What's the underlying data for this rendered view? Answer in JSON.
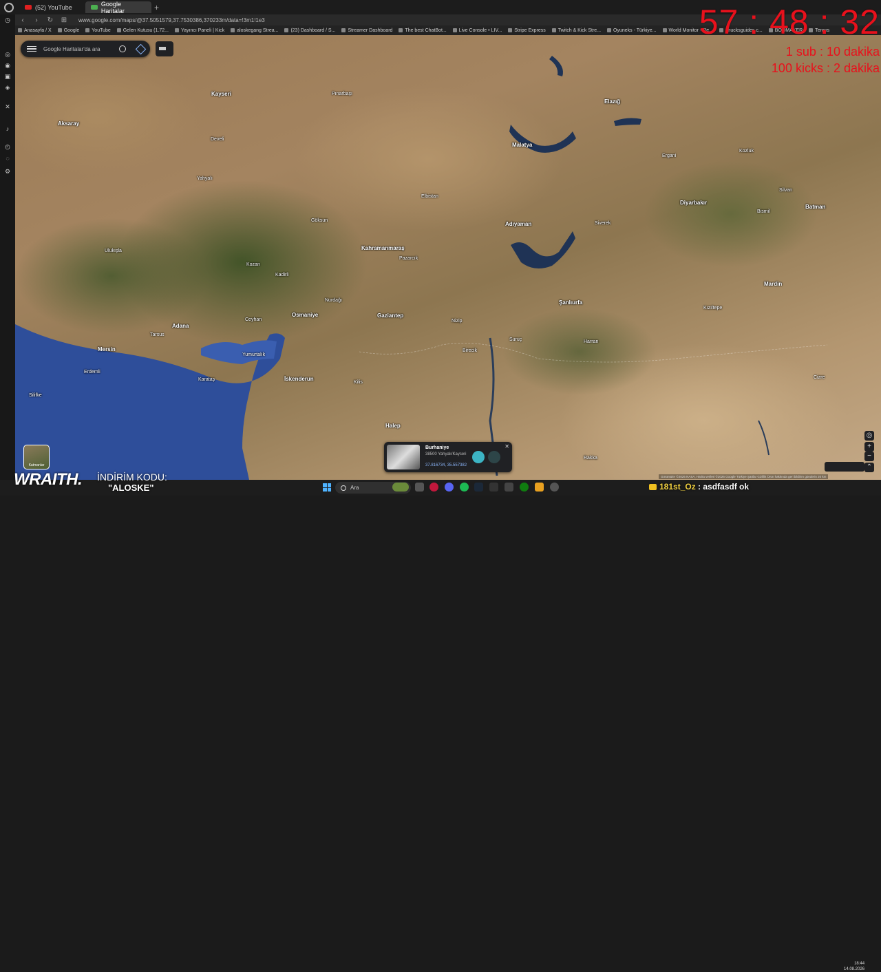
{
  "browser": {
    "tabs": [
      {
        "label": "(52) YouTube",
        "active": false,
        "icon": "youtube-icon"
      },
      {
        "label": "Google Haritalar",
        "active": true,
        "icon": "google-maps-icon"
      }
    ],
    "url": "www.google.com/maps/@37.5051579,37.7530386,370233m/data=!3m1!1e3",
    "bookmarks": [
      "Anasayfa / X",
      "Google",
      "YouTube",
      "Gelen Kutusu (1.72...",
      "Yayıncı Paneli | Kick",
      "aloskegang Strea...",
      "(23) Dashboard / S...",
      "Streamer Dashboard",
      "The best ChatBot...",
      "Live Console • LIV...",
      "Stripe Express",
      "Twitch & Kick Stre...",
      "Oyuneks - Türkiye...",
      "World Monitor - Re...",
      "chucksguides.c...",
      "BOOMAKER",
      "Terons"
    ]
  },
  "maps": {
    "search_placeholder": "Google Haritalar'da ara",
    "layers_label": "Katmanlar",
    "attribution": "Görüntüler ©2026 NASA, Harita verileri ©2026 Google   Türkiye   Şartlar   Gizlilik   Ürün hakkında geri bildirim gönderin   20 km",
    "place": {
      "name": "Burhaniye",
      "address": "38500 Yahyalı/Kayseri",
      "coords": "37.816734, 35.557382"
    },
    "cities": [
      {
        "name": "Kayseri",
        "big": true
      },
      {
        "name": "Aksaray",
        "big": true
      },
      {
        "name": "Malatya",
        "big": true
      },
      {
        "name": "Elazığ",
        "big": true
      },
      {
        "name": "Diyarbakır",
        "big": true
      },
      {
        "name": "Batman",
        "big": true
      },
      {
        "name": "Adıyaman",
        "big": true
      },
      {
        "name": "Kahramanmaraş",
        "big": true
      },
      {
        "name": "Adana",
        "big": true
      },
      {
        "name": "Mersin",
        "big": true
      },
      {
        "name": "Osmaniye",
        "big": true
      },
      {
        "name": "Gaziantep",
        "big": true
      },
      {
        "name": "Şanlıurfa",
        "big": true
      },
      {
        "name": "Mardin",
        "big": true
      },
      {
        "name": "İskenderun",
        "big": true
      },
      {
        "name": "Halep",
        "big": true
      },
      {
        "name": "Tarsus",
        "big": false
      },
      {
        "name": "Yumurtalık",
        "big": false
      },
      {
        "name": "Kozan",
        "big": false
      },
      {
        "name": "Kadirli",
        "big": false
      },
      {
        "name": "Nurdağı",
        "big": false
      },
      {
        "name": "Pazarcık",
        "big": false
      },
      {
        "name": "Siverek",
        "big": false
      },
      {
        "name": "Kozluk",
        "big": false
      },
      {
        "name": "Yahyalı",
        "big": false
      },
      {
        "name": "Develi",
        "big": false
      },
      {
        "name": "Göksun",
        "big": false
      },
      {
        "name": "Elbistan",
        "big": false
      },
      {
        "name": "Pınarbaşı",
        "big": false
      },
      {
        "name": "Karataş",
        "big": false
      },
      {
        "name": "Ceyhan",
        "big": false
      },
      {
        "name": "Kilis",
        "big": false
      },
      {
        "name": "Birecik",
        "big": false
      },
      {
        "name": "Suruç",
        "big": false
      },
      {
        "name": "Harran",
        "big": false
      },
      {
        "name": "Kızıltepe",
        "big": false
      },
      {
        "name": "Nizip",
        "big": false
      },
      {
        "name": "Ergani",
        "big": false
      },
      {
        "name": "Silvan",
        "big": false
      },
      {
        "name": "Cizre",
        "big": false
      },
      {
        "name": "Rakka",
        "big": false
      },
      {
        "name": "Bismil",
        "big": false
      },
      {
        "name": "Ulukışla",
        "big": false
      },
      {
        "name": "Erdemli",
        "big": false
      },
      {
        "name": "Silifke",
        "big": false
      }
    ]
  },
  "overlay": {
    "timer": "57 : 48 : 32",
    "rule1": "1 sub : 10 dakika",
    "rule2": "100 kicks : 2 dakika",
    "brand": "WRAITH.",
    "promo_label": "İNDİRİM KODU:",
    "promo_code": "\"ALOSKE\"",
    "chat_user": "181st_Oz",
    "chat_sep": " : ",
    "chat_message": "asdfasdf ok"
  },
  "taskbar": {
    "search_label": "Ara",
    "time": "18:44",
    "date": "14.08.2026"
  }
}
